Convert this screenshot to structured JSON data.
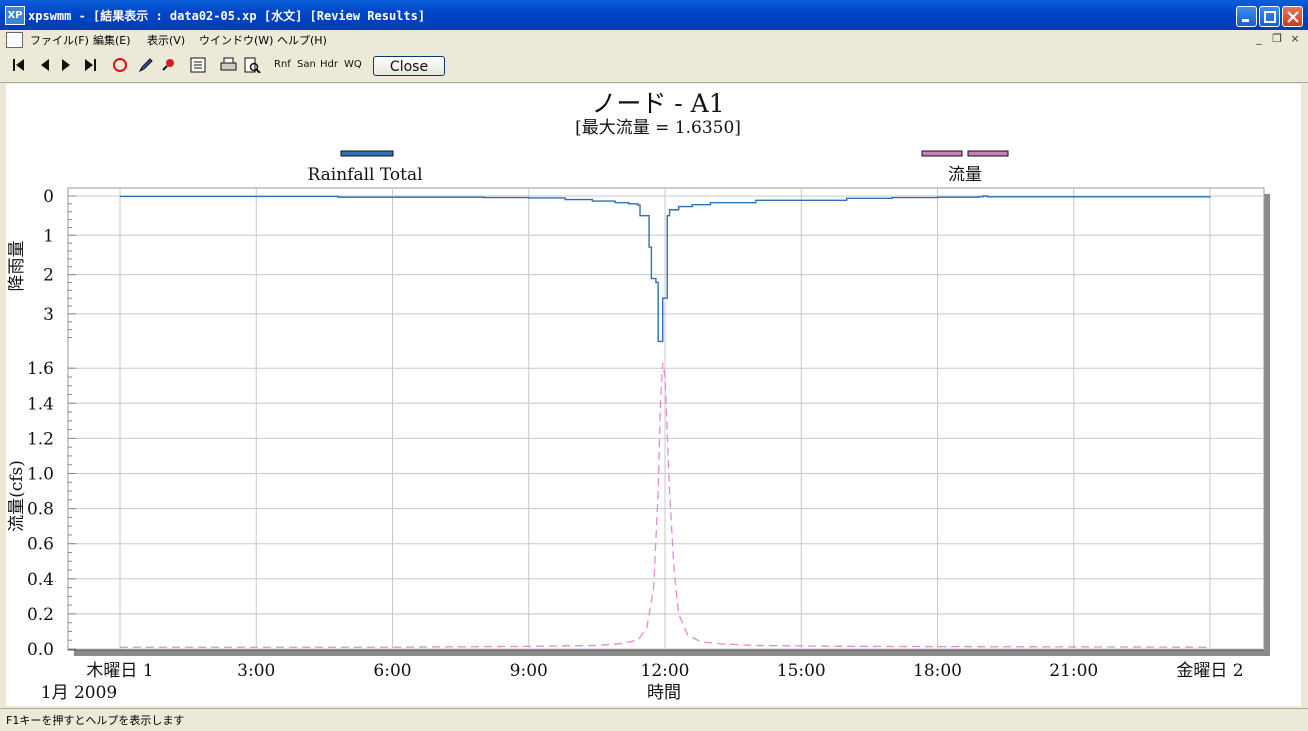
{
  "window": {
    "app_icon_text": "XP",
    "title": "xpswmm - [結果表示 : data02-05.xp [水文] [Review Results]"
  },
  "menu": [
    "ファイル(F)",
    "編集(E)",
    "表示(V)",
    "ウインドウ(W)",
    "ヘルプ(H)"
  ],
  "toolbar": {
    "icons": [
      "first-icon",
      "prev-icon",
      "next-icon",
      "last-icon",
      "circle-icon",
      "pencil-icon",
      "pin-icon",
      "list-icon",
      "print-icon",
      "preview-icon"
    ],
    "text_buttons": [
      "Rnf",
      "San",
      "Hdr",
      "WQ"
    ],
    "close_label": "Close"
  },
  "status": {
    "text": "F1キーを押すとヘルプを表示します"
  },
  "chart_data": {
    "type": "line",
    "title": "ノード - A1",
    "subtitle": "[最大流量 = 1.6350]",
    "legend": [
      {
        "name": "Rainfall Total",
        "color": "#2f6fb6",
        "position": "top-left"
      },
      {
        "name": "流量",
        "color": "#c77fbd",
        "position": "top-right"
      }
    ],
    "xlabel": "時間",
    "x_ticks": [
      "木曜日 1",
      "3:00",
      "6:00",
      "9:00",
      "12:00",
      "15:00",
      "18:00",
      "21:00",
      "金曜日 2"
    ],
    "x_start_sublabel": "1月 2009",
    "xlim_hours": [
      0,
      24
    ],
    "rain_panel": {
      "ylabel": "降雨量",
      "y_ticks": [
        "0",
        "1",
        "2",
        "3"
      ],
      "ylim": [
        0,
        3.75
      ],
      "inverted": true,
      "series": {
        "name": "Rainfall Total",
        "x": [
          0,
          4.0,
          4.8,
          6.0,
          8.0,
          9.0,
          9.8,
          10.4,
          10.9,
          11.2,
          11.4,
          11.45,
          11.6,
          11.65,
          11.7,
          11.75,
          11.8,
          11.85,
          11.9,
          11.95,
          12.0,
          12.05,
          12.1,
          12.3,
          12.6,
          13.0,
          14.0,
          16.0,
          17.0,
          18.0,
          18.9,
          19.0,
          19.1,
          19.3,
          20.0,
          24.0
        ],
        "y": [
          0.01,
          0.01,
          0.03,
          0.03,
          0.04,
          0.05,
          0.09,
          0.13,
          0.17,
          0.2,
          0.23,
          0.5,
          0.5,
          1.3,
          2.1,
          2.1,
          2.2,
          3.7,
          3.7,
          2.6,
          2.6,
          0.5,
          0.35,
          0.27,
          0.22,
          0.17,
          0.11,
          0.06,
          0.04,
          0.03,
          0.02,
          0.0,
          0.02,
          0.02,
          0.02,
          0.01
        ]
      }
    },
    "flow_panel": {
      "ylabel": "流量(cfs)",
      "y_ticks": [
        "0.0",
        "0.2",
        "0.4",
        "0.6",
        "0.8",
        "1.0",
        "1.2",
        "1.4",
        "1.6"
      ],
      "ylim": [
        0,
        1.6
      ],
      "series": {
        "name": "流量",
        "x": [
          0,
          6.0,
          9.0,
          10.5,
          11.0,
          11.4,
          11.6,
          11.75,
          11.85,
          11.9,
          11.95,
          12.0,
          12.1,
          12.2,
          12.3,
          12.5,
          12.8,
          13.2,
          14.0,
          16.0,
          24.0
        ],
        "y": [
          0.01,
          0.01,
          0.015,
          0.02,
          0.03,
          0.05,
          0.12,
          0.35,
          0.9,
          1.4,
          1.63,
          1.55,
          0.9,
          0.45,
          0.2,
          0.08,
          0.04,
          0.03,
          0.02,
          0.015,
          0.01
        ]
      }
    }
  }
}
